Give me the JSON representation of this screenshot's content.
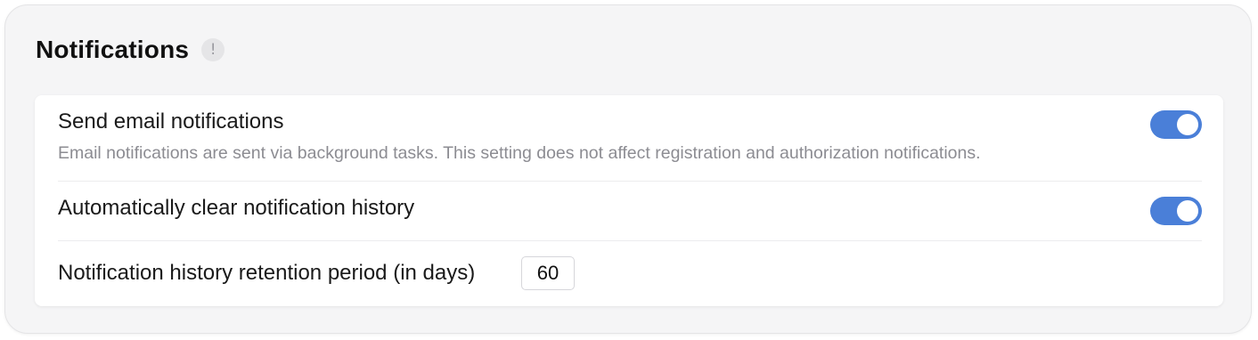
{
  "panel": {
    "title": "Notifications",
    "info_icon": "info-icon",
    "info_glyph": "!"
  },
  "settings": [
    {
      "label": "Send email notifications",
      "description": "Email notifications are sent via background tasks. This setting does not affect registration and authorization notifications.",
      "type": "toggle",
      "enabled": true
    },
    {
      "label": "Automatically clear notification history",
      "type": "toggle",
      "enabled": true
    },
    {
      "label": "Notification history retention period (in days)",
      "type": "number",
      "value": "60"
    }
  ],
  "colors": {
    "toggle_on": "#4a7fd8",
    "panel_bg": "#f5f5f6",
    "card_bg": "#ffffff",
    "description_text": "#8c8c92"
  }
}
